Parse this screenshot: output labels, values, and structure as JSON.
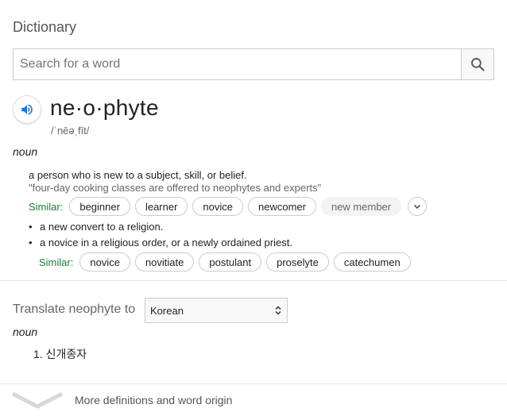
{
  "title": "Dictionary",
  "search": {
    "placeholder": "Search for a word",
    "value": ""
  },
  "entry": {
    "headword": "ne·o·phyte",
    "phonetic": "/ˈnēəˌfīt/",
    "pos": "noun",
    "senses": [
      {
        "definition": "a person who is new to a subject, skill, or belief.",
        "example": "\"four-day cooking classes are offered to neophytes and experts\"",
        "similar_label": "Similar:",
        "similar": [
          "beginner",
          "learner",
          "novice",
          "newcomer",
          "new member"
        ]
      }
    ],
    "sub_senses": [
      "a new convert to a religion.",
      "a novice in a religious order, or a newly ordained priest."
    ],
    "sub_similar_label": "Similar:",
    "sub_similar": [
      "novice",
      "novitiate",
      "postulant",
      "proselyte",
      "catechumen"
    ]
  },
  "translate": {
    "label": "Translate neophyte to",
    "language": "Korean",
    "pos": "noun",
    "items": [
      "1. 신개종자"
    ]
  },
  "more": {
    "label": "More definitions and word origin"
  },
  "colors": {
    "accent": "#1a73e8",
    "similar": "#188038"
  }
}
